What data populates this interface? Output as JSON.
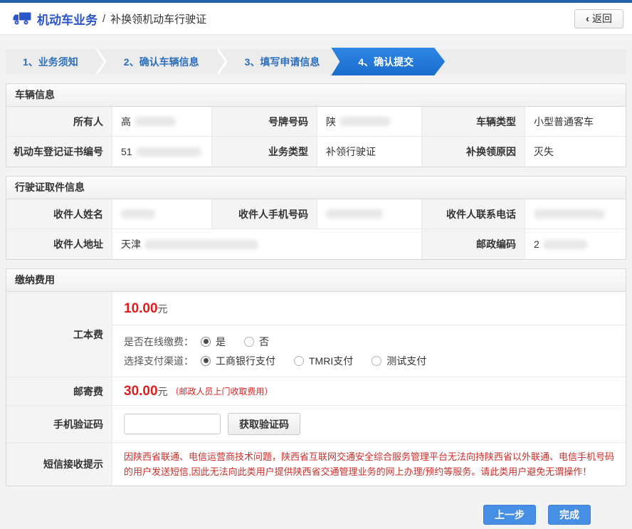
{
  "header": {
    "app_title": "机动车业务",
    "separator": "/",
    "page_title": "补换领机动车行驶证",
    "back_chevron": "‹",
    "back_label": "返回"
  },
  "steps": [
    {
      "label": "1、业务须知",
      "active": false
    },
    {
      "label": "2、确认车辆信息",
      "active": false
    },
    {
      "label": "3、填写申请信息",
      "active": false
    },
    {
      "label": "4、确认提交",
      "active": true
    }
  ],
  "vehicle_section": {
    "title": "车辆信息",
    "owner": {
      "label": "所有人",
      "value": "高"
    },
    "plate": {
      "label": "号牌号码",
      "value": "陕"
    },
    "vehicle_type": {
      "label": "车辆类型",
      "value": "小型普通客车"
    },
    "reg_cert_no": {
      "label": "机动车登记证书编号",
      "value": "51"
    },
    "business_type": {
      "label": "业务类型",
      "value": "补领行驶证"
    },
    "reason": {
      "label": "补换领原因",
      "value": "灭失"
    }
  },
  "pickup_section": {
    "title": "行驶证取件信息",
    "recipient_name": {
      "label": "收件人姓名",
      "value": ""
    },
    "recipient_mobile": {
      "label": "收件人手机号码",
      "value": ""
    },
    "recipient_phone": {
      "label": "收件人联系电话",
      "value": ""
    },
    "recipient_address": {
      "label": "收件人地址",
      "value": "天津"
    },
    "postal_code": {
      "label": "邮政编码",
      "value": "2"
    }
  },
  "payment_section": {
    "title": "缴纳费用",
    "production_fee": {
      "label": "工本费",
      "amount": "10.00",
      "currency": "元",
      "online_question": "是否在线缴费：",
      "online_options": [
        {
          "label": "是",
          "selected": true
        },
        {
          "label": "否",
          "selected": false
        }
      ],
      "channel_question": "选择支付渠道：",
      "channel_options": [
        {
          "label": "工商银行支付",
          "selected": true
        },
        {
          "label": "TMRI支付",
          "selected": false
        },
        {
          "label": "测试支付",
          "selected": false
        }
      ]
    },
    "mail_fee": {
      "label": "邮寄费",
      "amount": "30.00",
      "currency": "元",
      "note": "（邮政人员上门收取费用）"
    },
    "sms_code": {
      "label": "手机验证码",
      "input_value": "",
      "button_label": "获取验证码"
    },
    "sms_notice": {
      "label": "短信接收提示",
      "text": "因陕西省联通、电信运营商技术问题，陕西省互联网交通安全综合服务管理平台无法向持陕西省以外联通、电信手机号码的用户发送短信,因此无法向此类用户提供陕西省交通管理业务的网上办理/预约等服务。请此类用户避免无谓操作！"
    }
  },
  "footer": {
    "prev_label": "上一步",
    "finish_label": "完成"
  },
  "colors": {
    "top_border_blue": "#2563af",
    "title_blue": "#2b55c8",
    "step_text_blue": "#2d6fbe",
    "active_step_blue": "#1e78d8",
    "button_blue": "#478fe5",
    "fee_red": "#e21b1b",
    "notice_red": "#c9302c"
  }
}
